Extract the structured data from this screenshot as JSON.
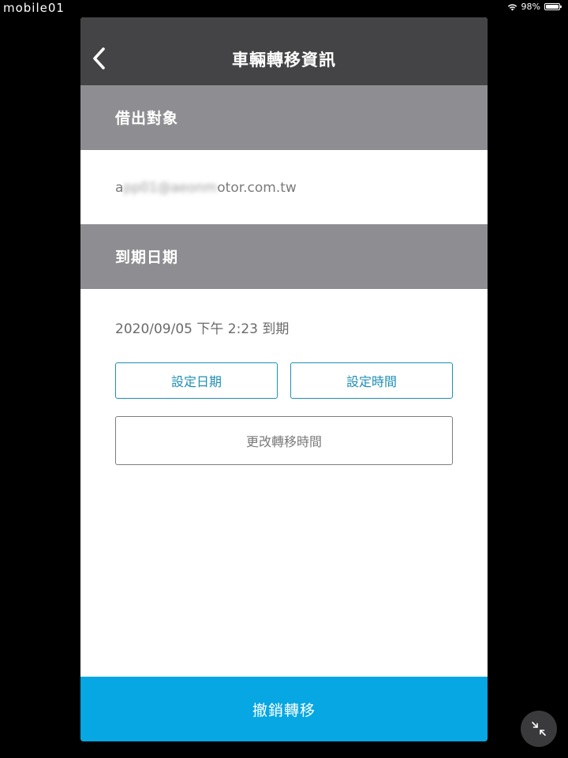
{
  "status_bar": {
    "watermark": "mobile01",
    "battery_text": "98%",
    "battery_level": 0.98,
    "wifi_icon": "wifi-icon",
    "battery_icon": "battery-icon"
  },
  "nav": {
    "title": "車輛轉移資訊",
    "back_icon": "chevron-left-icon"
  },
  "borrower_section": {
    "header": "借出對象",
    "email_visible_prefix": "a",
    "email_obscured": "pp01@aeonm",
    "email_visible_suffix": "otor.com.tw"
  },
  "expiry_section": {
    "header": "到期日期",
    "expiry_text": "2020/09/05 下午 2:23 到期",
    "set_date_label": "設定日期",
    "set_time_label": "設定時間",
    "change_time_label": "更改轉移時間"
  },
  "footer": {
    "revoke_label": "撤銷轉移"
  },
  "overlay": {
    "minimize_icon": "collapse-arrows-icon"
  },
  "colors": {
    "nav_bg": "#444446",
    "section_header_bg": "#8e8e92",
    "accent_teal": "#1e8fb3",
    "revoke_bg": "#06a7e2"
  }
}
